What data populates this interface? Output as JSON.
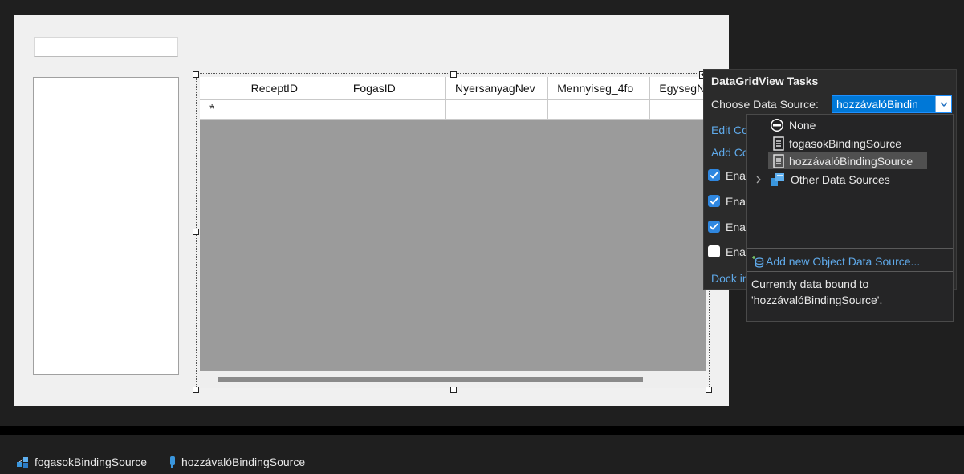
{
  "grid": {
    "columns": [
      "ReceptID",
      "FogasID",
      "NyersanyagNev",
      "Mennyiseg_4fo",
      "EgysegN"
    ],
    "new_row_marker": "*"
  },
  "tasks_panel": {
    "title": "DataGridView Tasks",
    "choose_data_source_label": "Choose Data Source:",
    "selected_data_source": "hozzávalóBindin",
    "links": [
      "Edit Co",
      "Add Co",
      "Dock in"
    ],
    "checkboxes": [
      {
        "label": "Enal",
        "checked": true
      },
      {
        "label": "Enal",
        "checked": true
      },
      {
        "label": "Enal",
        "checked": true
      },
      {
        "label": "Enal",
        "checked": false
      }
    ]
  },
  "data_source_dropdown": {
    "items": [
      {
        "label": "None",
        "icon": "none-icon",
        "selected": false
      },
      {
        "label": "fogasokBindingSource",
        "icon": "binding-source-icon",
        "selected": false
      },
      {
        "label": "hozzávalóBindingSource",
        "icon": "binding-source-icon",
        "selected": true
      },
      {
        "label": "Other Data Sources",
        "icon": "data-sources-icon",
        "expandable": true
      }
    ],
    "add_new_label": "Add new Object Data Source...",
    "description_line1": "Currently data bound to",
    "description_line2": "'hozzávalóBindingSource'."
  },
  "component_tray": {
    "items": [
      {
        "label": "fogasokBindingSource",
        "icon": "binding-source-tray-icon"
      },
      {
        "label": "hozzávalóBindingSource",
        "icon": "binding-source-tray-icon"
      }
    ]
  },
  "colors": {
    "accent": "#0078d7",
    "link": "#5fa9e9",
    "panel_bg": "#2b2b2b",
    "form_bg": "#f0f0f0",
    "grid_bg": "#9b9b9b"
  }
}
